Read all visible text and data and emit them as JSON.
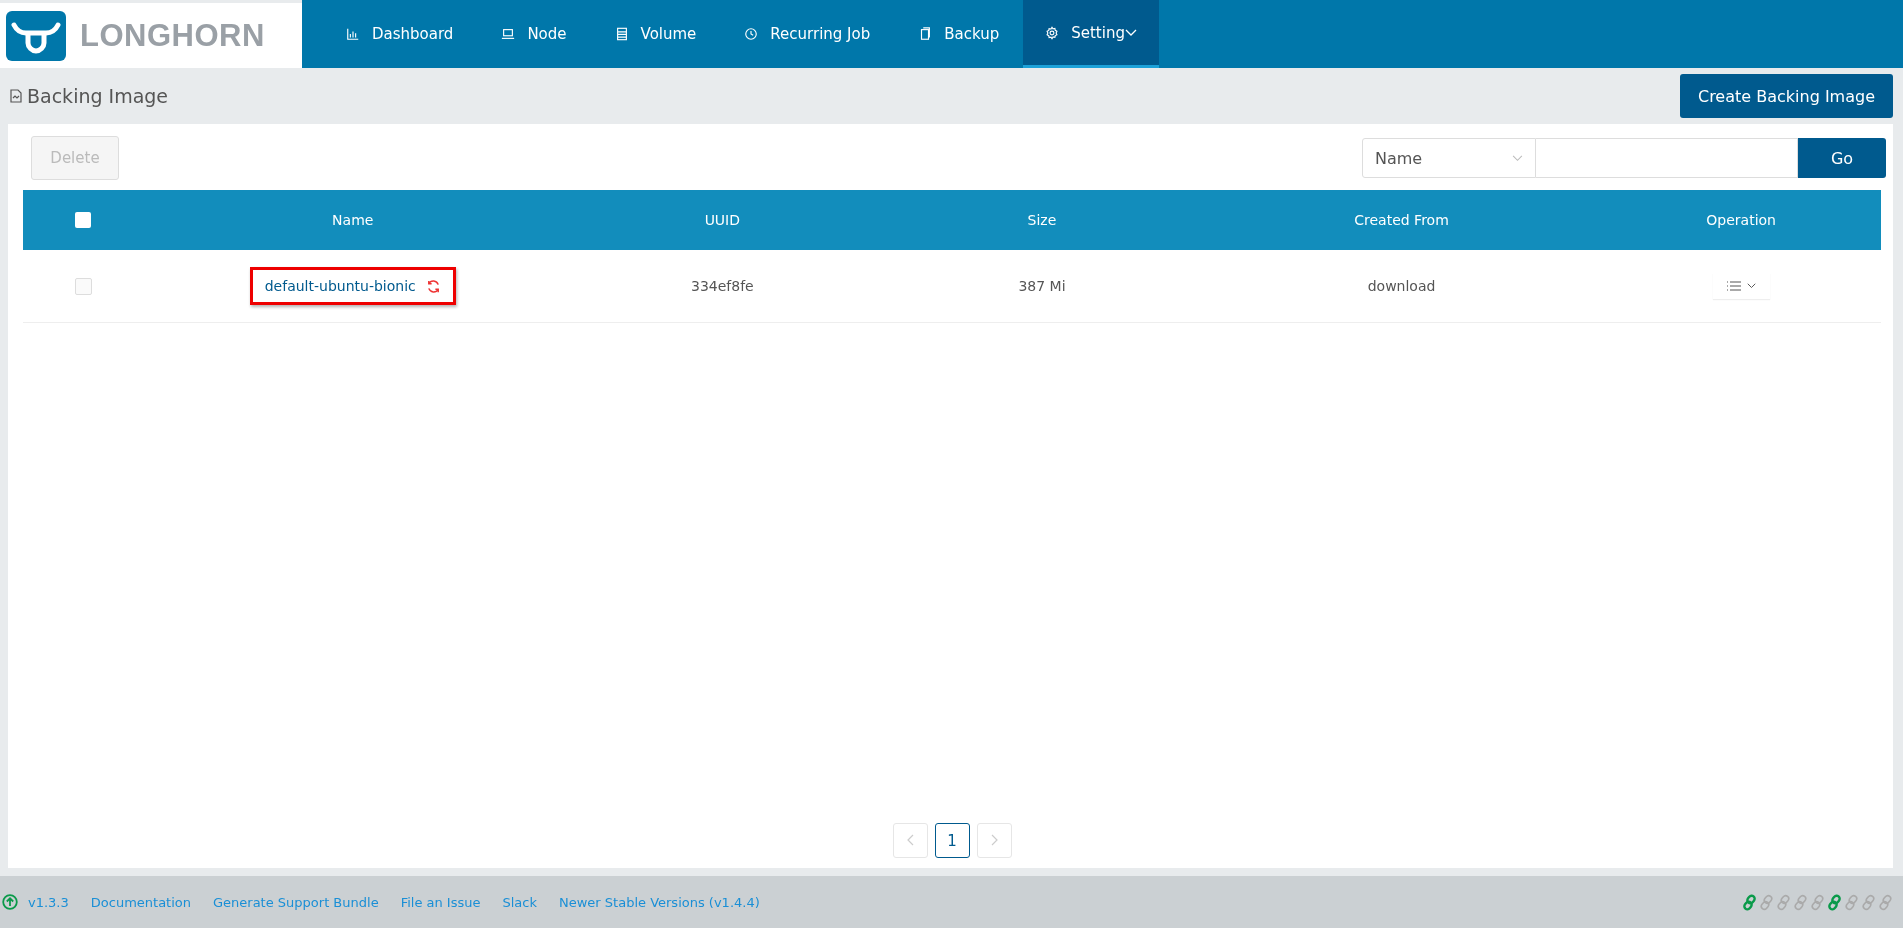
{
  "brand": {
    "name": "LONGHORN"
  },
  "nav": [
    {
      "label": "Dashboard",
      "kind": "chart",
      "selected": false
    },
    {
      "label": "Node",
      "kind": "laptop",
      "selected": false
    },
    {
      "label": "Volume",
      "kind": "list",
      "selected": false
    },
    {
      "label": "Recurring Job",
      "kind": "clock",
      "selected": false
    },
    {
      "label": "Backup",
      "kind": "copy",
      "selected": false
    },
    {
      "label": "Setting",
      "kind": "gear",
      "selected": true,
      "dropdown": true
    }
  ],
  "page": {
    "title": "Backing Image",
    "create_button": "Create Backing Image"
  },
  "toolbar": {
    "delete_button": {
      "label": "Delete",
      "disabled": true
    },
    "search": {
      "field": "Name",
      "go": "Go"
    }
  },
  "table": {
    "header_checked": false,
    "columns": [
      "Name",
      "UUID",
      "Size",
      "Created From",
      "Operation"
    ],
    "rows": [
      {
        "checked": false,
        "name": "default-ubuntu-bionic",
        "syncing": true,
        "highlighted": true,
        "uuid": "334ef8fe",
        "size": "387 Mi",
        "created_from": "download"
      }
    ]
  },
  "pagination": {
    "prev_disabled": true,
    "next_disabled": true,
    "pages": [
      {
        "label": "1",
        "selected": true
      }
    ]
  },
  "footer": {
    "links": [
      {
        "label": "v1.3.3",
        "kind": "version"
      },
      {
        "label": "Documentation",
        "kind": "link"
      },
      {
        "label": "Generate Support Bundle",
        "kind": "link"
      },
      {
        "label": "File an Issue",
        "kind": "link"
      },
      {
        "label": "Slack",
        "kind": "link"
      },
      {
        "label": "Newer Stable Versions (v1.4.4)",
        "kind": "link"
      }
    ],
    "connections": [
      {
        "connected": true
      },
      {
        "connected": false
      },
      {
        "connected": false
      },
      {
        "connected": false
      },
      {
        "connected": false
      },
      {
        "connected": true
      },
      {
        "connected": false
      },
      {
        "connected": false
      },
      {
        "connected": false
      }
    ]
  }
}
